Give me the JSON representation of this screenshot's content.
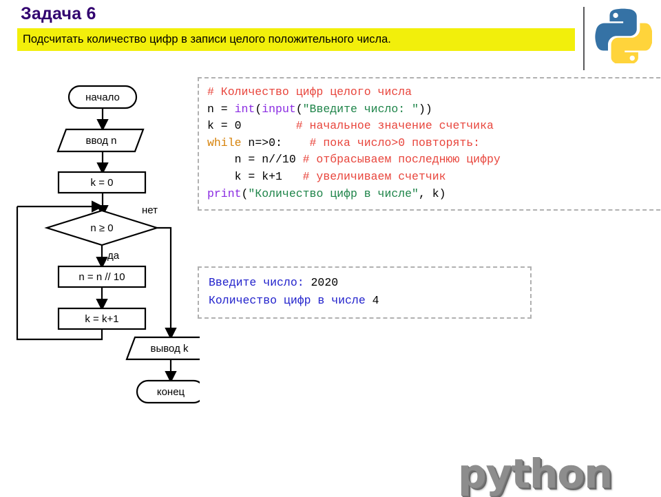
{
  "header": {
    "title": "Задача 6",
    "task_text": "Подсчитать количество цифр в записи целого положительного числа.",
    "title_color": "#31006F",
    "banner_color": "#F2EF0B"
  },
  "flowchart": {
    "nodes": {
      "start": "начало",
      "input": "ввод n",
      "init_k": "k = 0",
      "condition": "n ≥ 0",
      "divide": "n = n // 10",
      "increment": "k = k+1",
      "output": "вывод k",
      "end": "конец"
    },
    "branch_labels": {
      "no": "нет",
      "yes": "да"
    }
  },
  "code": {
    "lines": [
      [
        {
          "t": "# Количество цифр целого числа",
          "c": "comment"
        }
      ],
      [
        {
          "t": "n = ",
          "c": "plain"
        },
        {
          "t": "int",
          "c": "builtin"
        },
        {
          "t": "(",
          "c": "plain"
        },
        {
          "t": "input",
          "c": "builtin"
        },
        {
          "t": "(",
          "c": "plain"
        },
        {
          "t": "\"Введите число: \"",
          "c": "string"
        },
        {
          "t": "))",
          "c": "plain"
        }
      ],
      [
        {
          "t": "k = 0        ",
          "c": "plain"
        },
        {
          "t": "# начальное значение счетчика",
          "c": "comment"
        }
      ],
      [
        {
          "t": "while",
          "c": "keyword"
        },
        {
          "t": " n=>0:    ",
          "c": "plain"
        },
        {
          "t": "# пока число>0 повторять:",
          "c": "comment"
        }
      ],
      [
        {
          "t": "    n = n//10 ",
          "c": "plain"
        },
        {
          "t": "# отбрасываем последнюю цифру",
          "c": "comment"
        }
      ],
      [
        {
          "t": "    k = k+1   ",
          "c": "plain"
        },
        {
          "t": "# увеличиваем счетчик",
          "c": "comment"
        }
      ],
      [
        {
          "t": "print",
          "c": "builtin"
        },
        {
          "t": "(",
          "c": "plain"
        },
        {
          "t": "\"Количество цифр в числе\"",
          "c": "string"
        },
        {
          "t": ", k)",
          "c": "plain"
        }
      ]
    ]
  },
  "output": {
    "lines": [
      [
        {
          "t": "Введите число: ",
          "c": "prompt"
        },
        {
          "t": "2020",
          "c": "value"
        }
      ],
      [
        {
          "t": "Количество цифр в числе ",
          "c": "prompt"
        },
        {
          "t": "4",
          "c": "value"
        }
      ]
    ]
  },
  "branding": {
    "wordmark": "python",
    "logo_blue": "#3572A5",
    "logo_yellow": "#FFD43B"
  }
}
